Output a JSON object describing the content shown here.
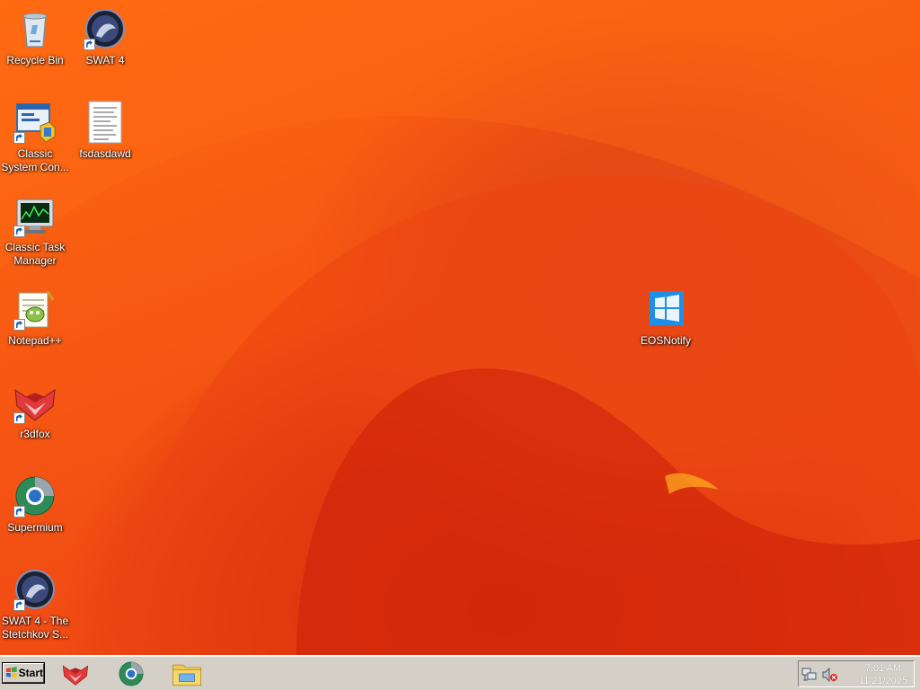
{
  "desktop": {
    "icons": [
      {
        "label": "Recycle Bin",
        "icon": "recycle-bin-icon"
      },
      {
        "label": "SWAT 4",
        "icon": "swat4-icon"
      },
      {
        "label": "Classic System Con...",
        "icon": "control-panel-icon"
      },
      {
        "label": "fsdasdawd",
        "icon": "text-document-icon"
      },
      {
        "label": "Classic Task Manager",
        "icon": "task-manager-icon"
      },
      {
        "label": "Notepad++",
        "icon": "notepad-plus-plus-icon"
      },
      {
        "label": "r3dfox",
        "icon": "r3dfox-icon"
      },
      {
        "label": "Supermium",
        "icon": "supermium-icon"
      },
      {
        "label": "SWAT 4 - The Stetchkov S...",
        "icon": "swat4-expansion-icon"
      },
      {
        "label": "EOSNotify",
        "icon": "windows-logo-icon"
      }
    ]
  },
  "taskbar": {
    "start_label": "Start",
    "pinned": [
      {
        "name": "r3dfox",
        "icon": "r3dfox-icon"
      },
      {
        "name": "Supermium",
        "icon": "supermium-icon"
      },
      {
        "name": "File Explorer",
        "icon": "folder-icon"
      }
    ],
    "tray": {
      "network_icon": "network-icon",
      "volume_icon": "volume-muted-icon",
      "time": "7:01 AM",
      "date": "11/21/2025"
    }
  },
  "colors": {
    "wallpaper_primary": "#f85c12",
    "wallpaper_dark": "#d42a0c",
    "taskbar": "#d4d0c8"
  }
}
